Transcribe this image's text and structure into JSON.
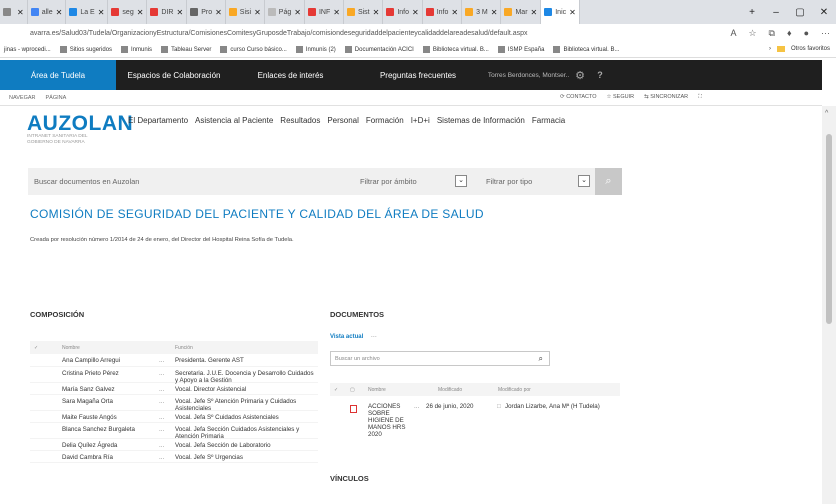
{
  "browser": {
    "tabs": [
      {
        "label": "",
        "color": "#888"
      },
      {
        "label": "alle",
        "color": "#4285f4"
      },
      {
        "label": "La E",
        "color": "#1e88e5"
      },
      {
        "label": "seg",
        "color": "#e53935"
      },
      {
        "label": "DIR",
        "color": "#e53935"
      },
      {
        "label": "Pro",
        "color": "#666"
      },
      {
        "label": "Sisi",
        "color": "#f9a825"
      },
      {
        "label": "Pág",
        "color": "#bbb"
      },
      {
        "label": "INF",
        "color": "#e53935"
      },
      {
        "label": "Sist",
        "color": "#f9a825"
      },
      {
        "label": "Info",
        "color": "#e53935"
      },
      {
        "label": "Info",
        "color": "#e53935"
      },
      {
        "label": "3 M",
        "color": "#f9a825"
      },
      {
        "label": "Mar",
        "color": "#f9a825"
      },
      {
        "label": "Inic",
        "color": "#1e88e5"
      }
    ],
    "url": "avarra.es/Salud03/Tudela/OrganizacionyEstructura/ComisionesComitesyGruposdeTrabajo/comisiondeseguridaddelpacienteycalidaddelareadesalud/default.aspx",
    "bookmarks": [
      "jinas - wprocedi...",
      "Sitios sugeridos",
      "Inmunis",
      "Tableau Server",
      "curso Curso básico...",
      "Inmunis (2)",
      "Documentación ACICI",
      "Biblioteca virtual. B...",
      "ISMP España",
      "Biblioteca virtual. B..."
    ],
    "other_bookmarks": "Otros favoritos"
  },
  "topnav": {
    "items": [
      "Área de Tudela",
      "Espacios de Colaboración",
      "Enlaces de interés",
      "Preguntas frecuentes"
    ],
    "user": "Torres Berdonces, Montser..",
    "help": "?"
  },
  "ribbon": {
    "left": [
      "NAVEGAR",
      "PÁGINA"
    ],
    "right": [
      "CONTACTO",
      "SEGUIR",
      "SINCRONIZAR"
    ]
  },
  "site": {
    "logo": "AUZOLAN",
    "logo_sub": "INTRANET SANITARIA DEL GOBIERNO DE NAVARRA",
    "nav": [
      "El Departamento",
      "Asistencia al Paciente",
      "Resultados",
      "Personal",
      "Formación",
      "I+D+i",
      "Sistemas de Información",
      "Farmacia"
    ]
  },
  "search": {
    "placeholder": "Buscar documentos en Auzolan",
    "scope": "Filtrar por ámbito",
    "type": "Filtrar por tipo"
  },
  "page": {
    "title": "COMISIÓN DE SEGURIDAD DEL PACIENTE Y CALIDAD DEL ÁREA DE SALUD",
    "desc": "Creada por resolución número 1/2014 de 24 de enero, del Director del Hospital Reina Sofía de Tudela."
  },
  "composicion": {
    "heading": "COMPOSICIÓN",
    "col_name": "Nombre",
    "col_func": "Función",
    "rows": [
      {
        "n": "Ana Campillo Arregui",
        "f": "Presidenta. Gerente AST"
      },
      {
        "n": "Cristina Prieto Pérez",
        "f": "Secretaria. J.U.E. Docencia y Desarrollo Cuidados y Apoyo a la Gestión"
      },
      {
        "n": "María Sanz Galvez",
        "f": "Vocal. Director Asistencial"
      },
      {
        "n": "Sara Magaña Orta",
        "f": "Vocal. Jefe Sº Atención Primaria y Cuidados Asistenciales"
      },
      {
        "n": "Maite Fauste Angós",
        "f": "Vocal. Jefa Sº Cuidados Asistenciales"
      },
      {
        "n": "Blanca Sanchez Burgaleta",
        "f": "Vocal. Jefa Sección Cuidados Asistenciales y Atención Primaria"
      },
      {
        "n": "Delia Quílez Ágreda",
        "f": "Vocal. Jefa Sección de Laboratorio"
      },
      {
        "n": "David Cambra Ría",
        "f": "Vocal. Jefe Sº Urgencias"
      }
    ]
  },
  "documentos": {
    "heading": "DOCUMENTOS",
    "vista": "Vista actual",
    "dots": "···",
    "search": "Buscar un archivo",
    "cols": [
      "Nombre",
      "Modificado",
      "Modificado por"
    ],
    "row": {
      "name": "ACCIONES SOBRE HIGIENE DE MANOS HRS 2020",
      "date": "26 de junio, 2020",
      "by": "Jordan Lizarbe, Ana Mª (H Tudela)"
    }
  },
  "vinculos": {
    "heading": "VÍNCULOS"
  }
}
